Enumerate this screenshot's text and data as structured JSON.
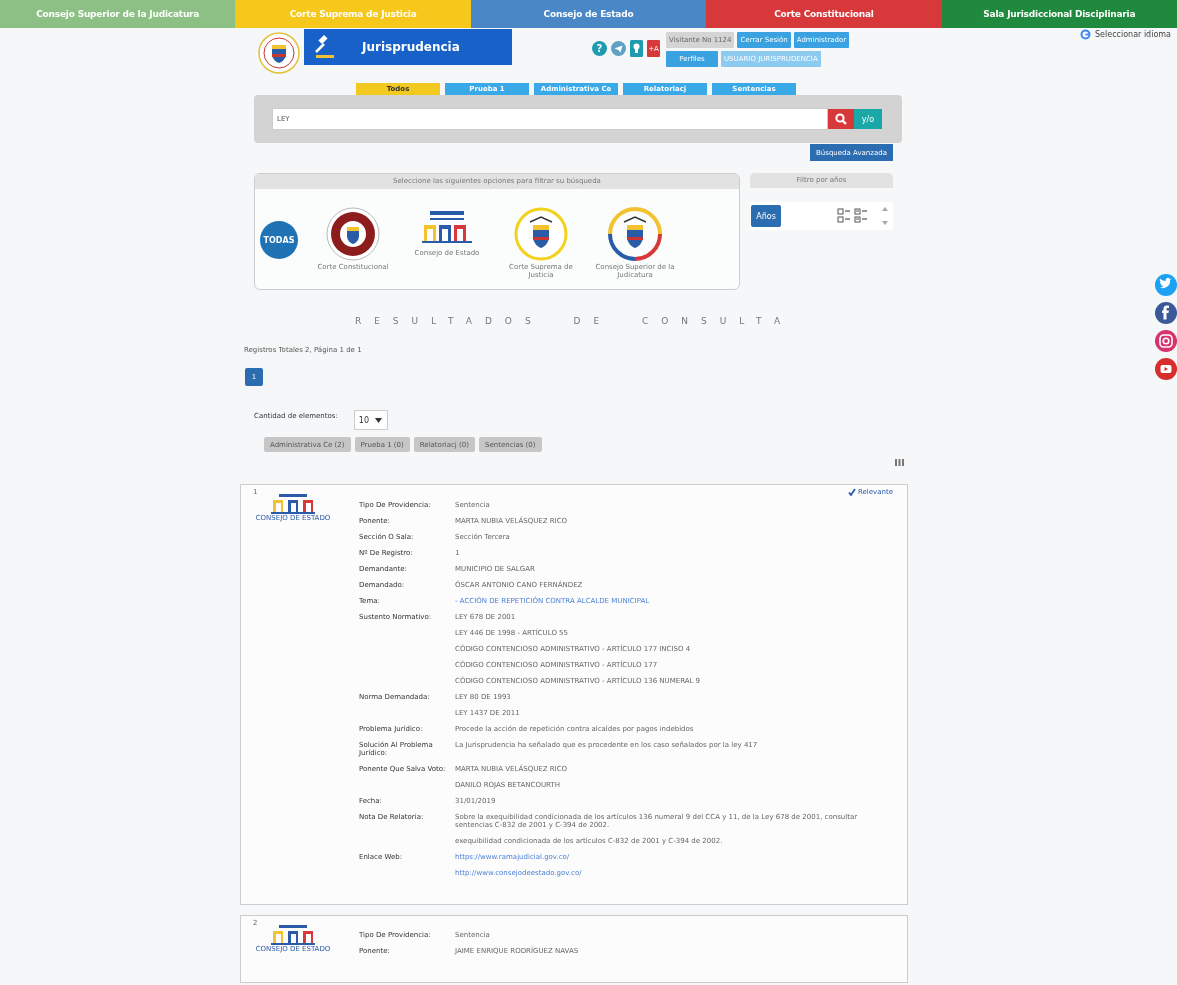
{
  "top_nav": [
    {
      "label": "Consejo Superior de la Judicatura",
      "color": "#8cc084"
    },
    {
      "label": "Corte Suprema de Justicia",
      "color": "#f6c81c"
    },
    {
      "label": "Consejo de Estado",
      "color": "#4a87c6"
    },
    {
      "label": "Corte Constitucional",
      "color": "#d7383a"
    },
    {
      "label": "Sala Jurisdiccional Disciplinaria",
      "color": "#1f8a3d"
    }
  ],
  "language": {
    "label": "Seleccionar idioma"
  },
  "header": {
    "banner_title": "Jurisprudencia",
    "quick_icons": [
      {
        "kind": "help",
        "label": "?"
      },
      {
        "kind": "send"
      },
      {
        "kind": "bulb"
      },
      {
        "kind": "text",
        "label": "+A"
      }
    ],
    "account_buttons": [
      {
        "label": "Visitante No 1124",
        "kind": "counter"
      },
      {
        "label": "Cerrar Sesión",
        "kind": "action"
      },
      {
        "label": "Administrador",
        "kind": "action"
      },
      {
        "label": "Perfiles",
        "kind": "action"
      },
      {
        "label": "USUARIO JURISPRUDENCIA",
        "kind": "user"
      }
    ]
  },
  "tabs": [
    {
      "label": "Todos",
      "selected": true
    },
    {
      "label": "Prueba 1",
      "selected": false
    },
    {
      "label": "Administrativa Ce",
      "selected": false
    },
    {
      "label": "Relatoriacj",
      "selected": false
    },
    {
      "label": "Sentencias",
      "selected": false
    }
  ],
  "search": {
    "value": "LEY",
    "andor_label": "y/o",
    "advanced_label": "Búsqueda Avanzada"
  },
  "filter": {
    "title": "Seleccione las siguientes opciones para filtrar su búsqueda",
    "options": [
      {
        "kind": "todas",
        "label": "TODAS"
      },
      {
        "kind": "seal-red",
        "label": "Corte Constitucional"
      },
      {
        "kind": "building",
        "label": "Consejo de Estado"
      },
      {
        "kind": "seal-yellow",
        "label": "Corte Suprema de Justicia"
      },
      {
        "kind": "seal-tricolor",
        "label": "Consejo Superior de la Judicatura"
      }
    ]
  },
  "years": {
    "title": "Filtro por años",
    "button": "Años"
  },
  "results": {
    "title": "RESULTADOS DE CONSULTA",
    "summary": "Registros Totales 2, Página 1 de 1",
    "pages": [
      {
        "label": "1",
        "selected": true
      }
    ],
    "page_size": {
      "label": "Cantidad de elementos:",
      "value": "10"
    },
    "groups": [
      "Administrativa Ce (2)",
      "Prueba 1 (0)",
      "Relatoriacj (0)",
      "Sentencias (0)"
    ],
    "cards": [
      {
        "number": "1",
        "relevant": true,
        "relevant_label": "Relevante",
        "logo_label": "CONSEJO DE ESTADO",
        "fields": [
          {
            "label": "Tipo De Providencia:",
            "kind": "text",
            "values": [
              "Sentencia"
            ]
          },
          {
            "label": "Ponente:",
            "kind": "text",
            "values": [
              "MARTA NUBIA VELÁSQUEZ RICO"
            ]
          },
          {
            "label": "Sección O Sala:",
            "kind": "text",
            "values": [
              "Sección Tercera"
            ]
          },
          {
            "label": "Nº De Registro:",
            "kind": "text",
            "values": [
              "1"
            ]
          },
          {
            "label": "Demandante:",
            "kind": "text",
            "values": [
              "MUNICIPIO DE SALGAR"
            ]
          },
          {
            "label": "Demandado:",
            "kind": "text",
            "values": [
              "ÓSCAR ANTONIO CANO FERNÁNDEZ"
            ]
          },
          {
            "label": "Tema:",
            "kind": "link",
            "values": [
              "- ACCIÓN DE REPETICIÓN CONTRA ALCALDE MUNICIPAL"
            ]
          },
          {
            "label": "Sustento Normativo:",
            "kind": "text",
            "values": [
              "LEY 678 DE 2001",
              "LEY 446 DE 1998 - ARTÍCULO 55",
              "CÓDIGO CONTENCIOSO ADMINISTRATIVO - ARTÍCULO 177 INCISO 4",
              "CÓDIGO CONTENCIOSO ADMINISTRATIVO - ARTÍCULO 177",
              "CÓDIGO CONTENCIOSO ADMINISTRATIVO - ARTÍCULO 136 NUMERAL 9"
            ]
          },
          {
            "label": "Norma Demandada:",
            "kind": "text",
            "values": [
              "LEY 80 DE 1993",
              "LEY 1437 DE 2011"
            ]
          },
          {
            "label": "Problema Jurídico:",
            "kind": "text",
            "values": [
              "Procede la acción de repetición contra alcaldes por pagos indebidos"
            ]
          },
          {
            "label": "Solución Al Problema Jurídico:",
            "kind": "text",
            "values": [
              "La Jurisprudencia ha señalado que es procedente en los caso señalados por la ley 417"
            ]
          },
          {
            "label": "Ponente Que Salva Voto:",
            "kind": "text",
            "values": [
              "MARTA NUBIA VELÁSQUEZ RICO",
              "DANILO ROJAS BETANCOURTH"
            ]
          },
          {
            "label": "Fecha:",
            "kind": "text",
            "values": [
              "31/01/2019"
            ]
          },
          {
            "label": "Nota De Relatoria:",
            "kind": "text",
            "values": [
              "Sobre la exequibilidad condicionada de los artículos 136 numeral 9 del CCA y 11, de la Ley 678 de 2001, consultar sentencias C-832 de 2001 y C-394 de 2002.",
              "exequibilidad condicionada de los artículos C-832 de 2001 y C-394 de 2002."
            ]
          },
          {
            "label": "Enlace Web:",
            "kind": "link",
            "values": [
              "https://www.ramajudicial.gov.co/",
              "http://www.consejodeestado.gov.co/"
            ]
          }
        ]
      },
      {
        "number": "2",
        "relevant": false,
        "logo_label": "CONSEJO DE ESTADO",
        "fields": [
          {
            "label": "Tipo De Providencia:",
            "kind": "text",
            "values": [
              "Sentencia"
            ]
          },
          {
            "label": "Ponente:",
            "kind": "text",
            "values": [
              "JAIME ENRIQUE RODRÍGUEZ NAVAS"
            ]
          }
        ]
      }
    ]
  }
}
